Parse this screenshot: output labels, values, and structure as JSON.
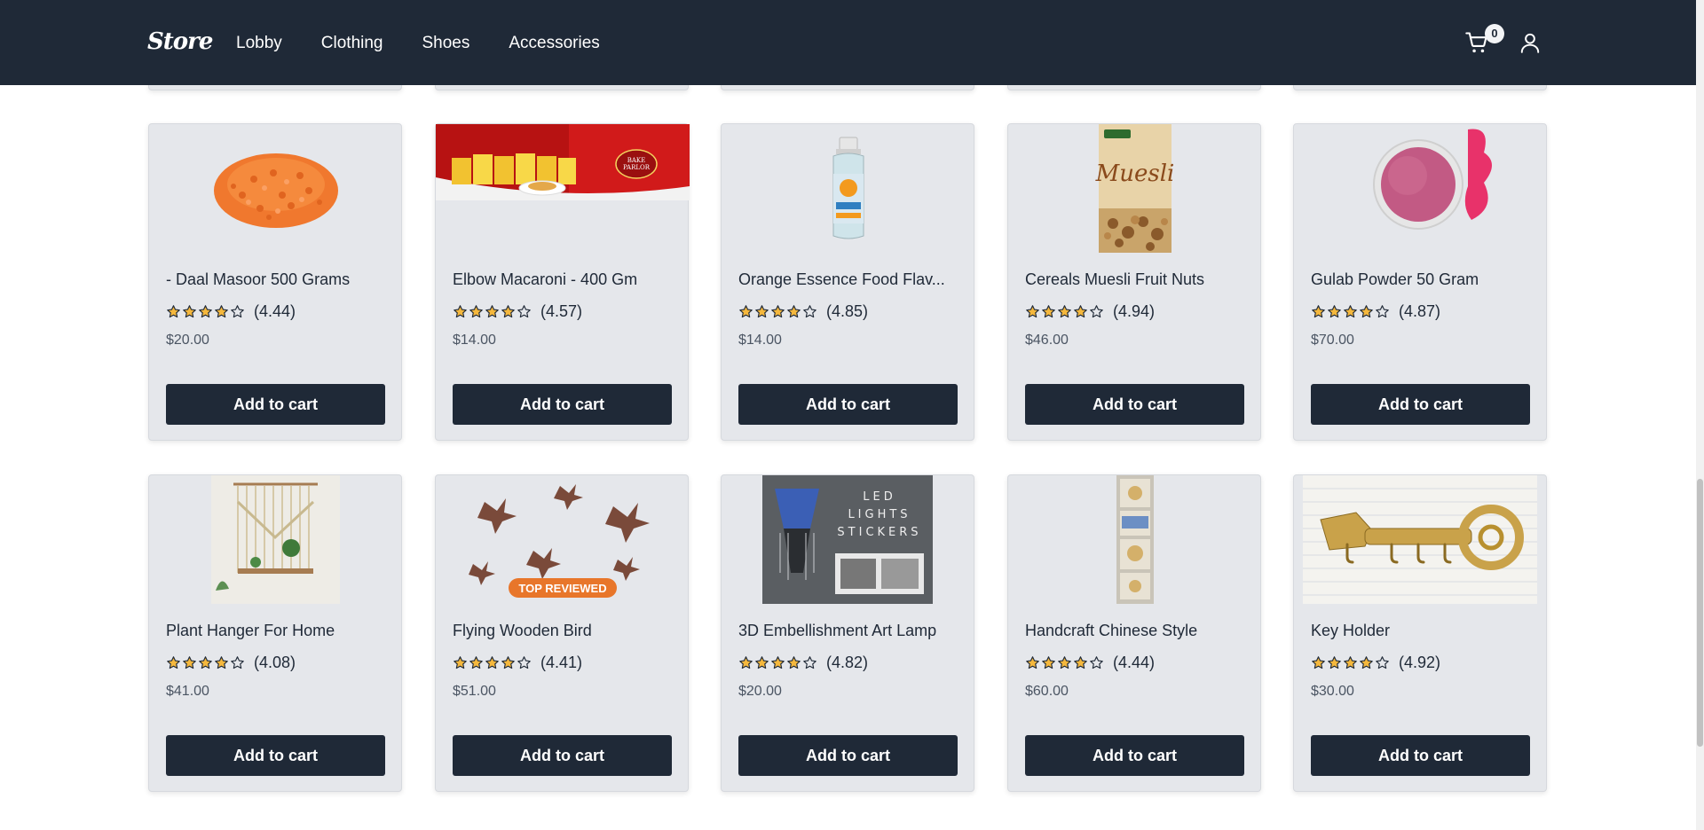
{
  "header": {
    "brand": "Store",
    "nav": [
      "Lobby",
      "Clothing",
      "Shoes",
      "Accessories"
    ],
    "cart_count": "0",
    "cart_icon": "cart-icon",
    "user_icon": "user-icon"
  },
  "colors": {
    "topbar": "#1f2937",
    "card_bg": "#e5e7eb",
    "button_bg": "#1f2937",
    "star_fill": "#f5b83d"
  },
  "products": [
    {
      "name": "- Daal Masoor 500 Grams",
      "rating": "(4.44)",
      "stars": 4,
      "price": "$20.00",
      "button": "Add to cart"
    },
    {
      "name": "Elbow Macaroni - 400 Gm",
      "rating": "(4.57)",
      "stars": 4,
      "price": "$14.00",
      "button": "Add to cart"
    },
    {
      "name": "Orange Essence Food Flav...",
      "rating": "(4.85)",
      "stars": 4,
      "price": "$14.00",
      "button": "Add to cart"
    },
    {
      "name": "Cereals Muesli Fruit Nuts",
      "rating": "(4.94)",
      "stars": 4,
      "price": "$46.00",
      "button": "Add to cart"
    },
    {
      "name": "Gulab Powder 50 Gram",
      "rating": "(4.87)",
      "stars": 4,
      "price": "$70.00",
      "button": "Add to cart"
    },
    {
      "name": "Plant Hanger For Home",
      "rating": "(4.08)",
      "stars": 4,
      "price": "$41.00",
      "button": "Add to cart"
    },
    {
      "name": "Flying Wooden Bird",
      "rating": "(4.41)",
      "stars": 4,
      "price": "$51.00",
      "button": "Add to cart"
    },
    {
      "name": "3D Embellishment Art Lamp",
      "rating": "(4.82)",
      "stars": 4,
      "price": "$20.00",
      "button": "Add to cart"
    },
    {
      "name": "Handcraft Chinese Style",
      "rating": "(4.44)",
      "stars": 4,
      "price": "$60.00",
      "button": "Add to cart"
    },
    {
      "name": "Key Holder",
      "rating": "(4.92)",
      "stars": 4,
      "price": "$30.00",
      "button": "Add to cart"
    }
  ],
  "image_text": {
    "bake_parlor": "BAKE PARLOR",
    "muesli": "Muesli",
    "top_reviewed": "TOP REVIEWED",
    "led_lights_stickers": "LED LIGHTS STICKERS"
  }
}
